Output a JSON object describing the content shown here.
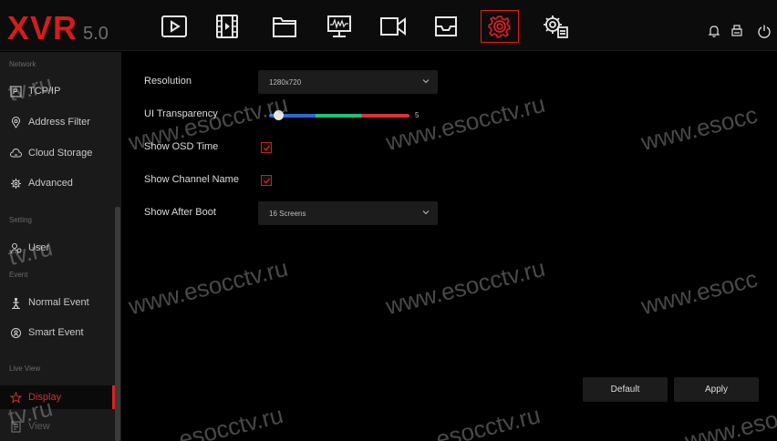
{
  "logo": {
    "brand": "XVR",
    "version": "5.0"
  },
  "nav": {
    "items": [
      "playback-icon",
      "film-icon",
      "folder-icon",
      "monitor-icon",
      "camera-icon",
      "storage-icon",
      "settings-icon",
      "system-settings-icon"
    ],
    "active": "settings-icon"
  },
  "toolbar": {
    "icons": [
      "bell-icon",
      "printer-icon",
      "power-icon"
    ]
  },
  "sidebar": {
    "categories": {
      "network": "Network",
      "setting": "Setting",
      "event": "Event",
      "live_view": "Live View"
    },
    "items": {
      "tcpip": "TCP/IP",
      "address_filter": "Address Filter",
      "cloud_storage": "Cloud Storage",
      "advanced": "Advanced",
      "user": "User",
      "normal_event": "Normal Event",
      "smart_event": "Smart Event",
      "display": "Display",
      "view": "View"
    },
    "active": "display"
  },
  "form": {
    "resolution": {
      "label": "Resolution",
      "value": "1280x720"
    },
    "ui_transparency": {
      "label": "UI Transparency",
      "value": "5",
      "level_fraction": 0.05
    },
    "show_osd_time": {
      "label": "Show OSD Time",
      "checked": true
    },
    "show_channel_name": {
      "label": "Show Channel Name",
      "checked": true
    },
    "show_after_boot": {
      "label": "Show After Boot",
      "value": "16 Screens"
    }
  },
  "buttons": {
    "default": "Default",
    "apply": "Apply"
  },
  "watermark": {
    "text": "www.esocctv.ru",
    "text_short_left": "tv.ru",
    "text_short_right": "www.esocc",
    "text_bottom_left": ".esocctv.ru"
  },
  "colors": {
    "accent": "#e02020",
    "background": "#000000",
    "sidebar": "#1a1a1a"
  }
}
